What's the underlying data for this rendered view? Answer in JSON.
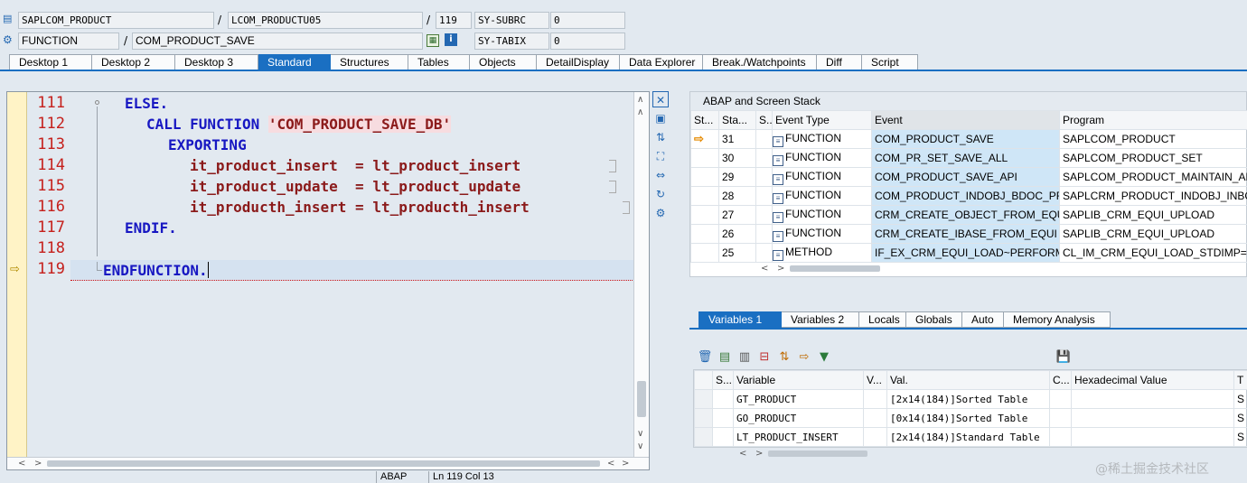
{
  "header": {
    "program": "SAPLCOM_PRODUCT",
    "include": "LCOM_PRODUCTU05",
    "line": "119",
    "sy_subrc_label": "SY-SUBRC",
    "sy_subrc_value": "0",
    "kind": "FUNCTION",
    "name": "COM_PRODUCT_SAVE",
    "sy_tabix_label": "SY-TABIX",
    "sy_tabix_value": "0",
    "sep": "/"
  },
  "tabs": [
    "Desktop 1",
    "Desktop 2",
    "Desktop 3",
    "Standard",
    "Structures",
    "Tables",
    "Objects",
    "DetailDisplay",
    "Data Explorer",
    "Break./Watchpoints",
    "Diff",
    "Script"
  ],
  "active_tab": "Standard",
  "code": {
    "line_numbers": [
      "111",
      "112",
      "113",
      "114",
      "115",
      "116",
      "117",
      "118",
      "119"
    ],
    "l111_kw": "ELSE.",
    "l112_kw": "CALL FUNCTION",
    "l112_str": "'COM_PRODUCT_SAVE_DB'",
    "l113_kw": "EXPORTING",
    "l114_a": "it_product_insert",
    "l114_op": "=",
    "l114_b": "lt_product_insert",
    "l115_a": "it_product_update",
    "l115_op": "=",
    "l115_b": "lt_product_update",
    "l116_a": "it_producth_insert",
    "l116_op": "=",
    "l116_b": "lt_producth_insert",
    "l117_kw": "ENDIF.",
    "l119_kw": "ENDFUNCTION."
  },
  "status": {
    "lang": "ABAP",
    "pos": "Ln 119 Col  13"
  },
  "stack": {
    "title": "ABAP and Screen Stack",
    "headers": [
      "St...",
      "Sta...",
      "S...",
      "Event Type",
      "Event",
      "Program"
    ],
    "rows": [
      {
        "level": "31",
        "type": "FUNCTION",
        "event": "COM_PRODUCT_SAVE",
        "program": "SAPLCOM_PRODUCT",
        "current": true
      },
      {
        "level": "30",
        "type": "FUNCTION",
        "event": "COM_PR_SET_SAVE_ALL",
        "program": "SAPLCOM_PRODUCT_SET",
        "current": false
      },
      {
        "level": "29",
        "type": "FUNCTION",
        "event": "COM_PRODUCT_SAVE_API",
        "program": "SAPLCOM_PRODUCT_MAINTAIN_API",
        "current": false
      },
      {
        "level": "28",
        "type": "FUNCTION",
        "event": "COM_PRODUCT_INDOBJ_BDOC_PR...",
        "program": "SAPLCRM_PRODUCT_INDOBJ_INBOUN",
        "current": false
      },
      {
        "level": "27",
        "type": "FUNCTION",
        "event": "CRM_CREATE_OBJECT_FROM_EQUI",
        "program": "SAPLIB_CRM_EQUI_UPLOAD",
        "current": false
      },
      {
        "level": "26",
        "type": "FUNCTION",
        "event": "CRM_CREATE_IBASE_FROM_EQUI",
        "program": "SAPLIB_CRM_EQUI_UPLOAD",
        "current": false
      },
      {
        "level": "25",
        "type": "METHOD",
        "event": "IF_EX_CRM_EQUI_LOAD~PERFORM...",
        "program": "CL_IM_CRM_EQUI_LOAD_STDIMP===",
        "current": false
      }
    ]
  },
  "vartabs": [
    "Variables 1",
    "Variables 2",
    "Locals",
    "Globals",
    "Auto",
    "Memory Analysis"
  ],
  "active_vartab": "Variables 1",
  "vars": {
    "headers": [
      "S...",
      "Variable",
      "V...",
      "Val.",
      "C...",
      "Hexadecimal Value",
      "T"
    ],
    "rows": [
      {
        "name": "GT_PRODUCT",
        "value": "[2x14(184)]Sorted Table",
        "t": "S"
      },
      {
        "name": "GO_PRODUCT",
        "value": "[0x14(184)]Sorted Table",
        "t": "S"
      },
      {
        "name": "LT_PRODUCT_INSERT",
        "value": "[2x14(184)]Standard Table",
        "t": "S"
      }
    ]
  },
  "watermark": "@稀土掘金技术社区",
  "colors": {
    "accent": "#1a6fc2",
    "keyword": "#1717c2",
    "identifier": "#8b1a1a",
    "line_number": "#c5201c"
  }
}
